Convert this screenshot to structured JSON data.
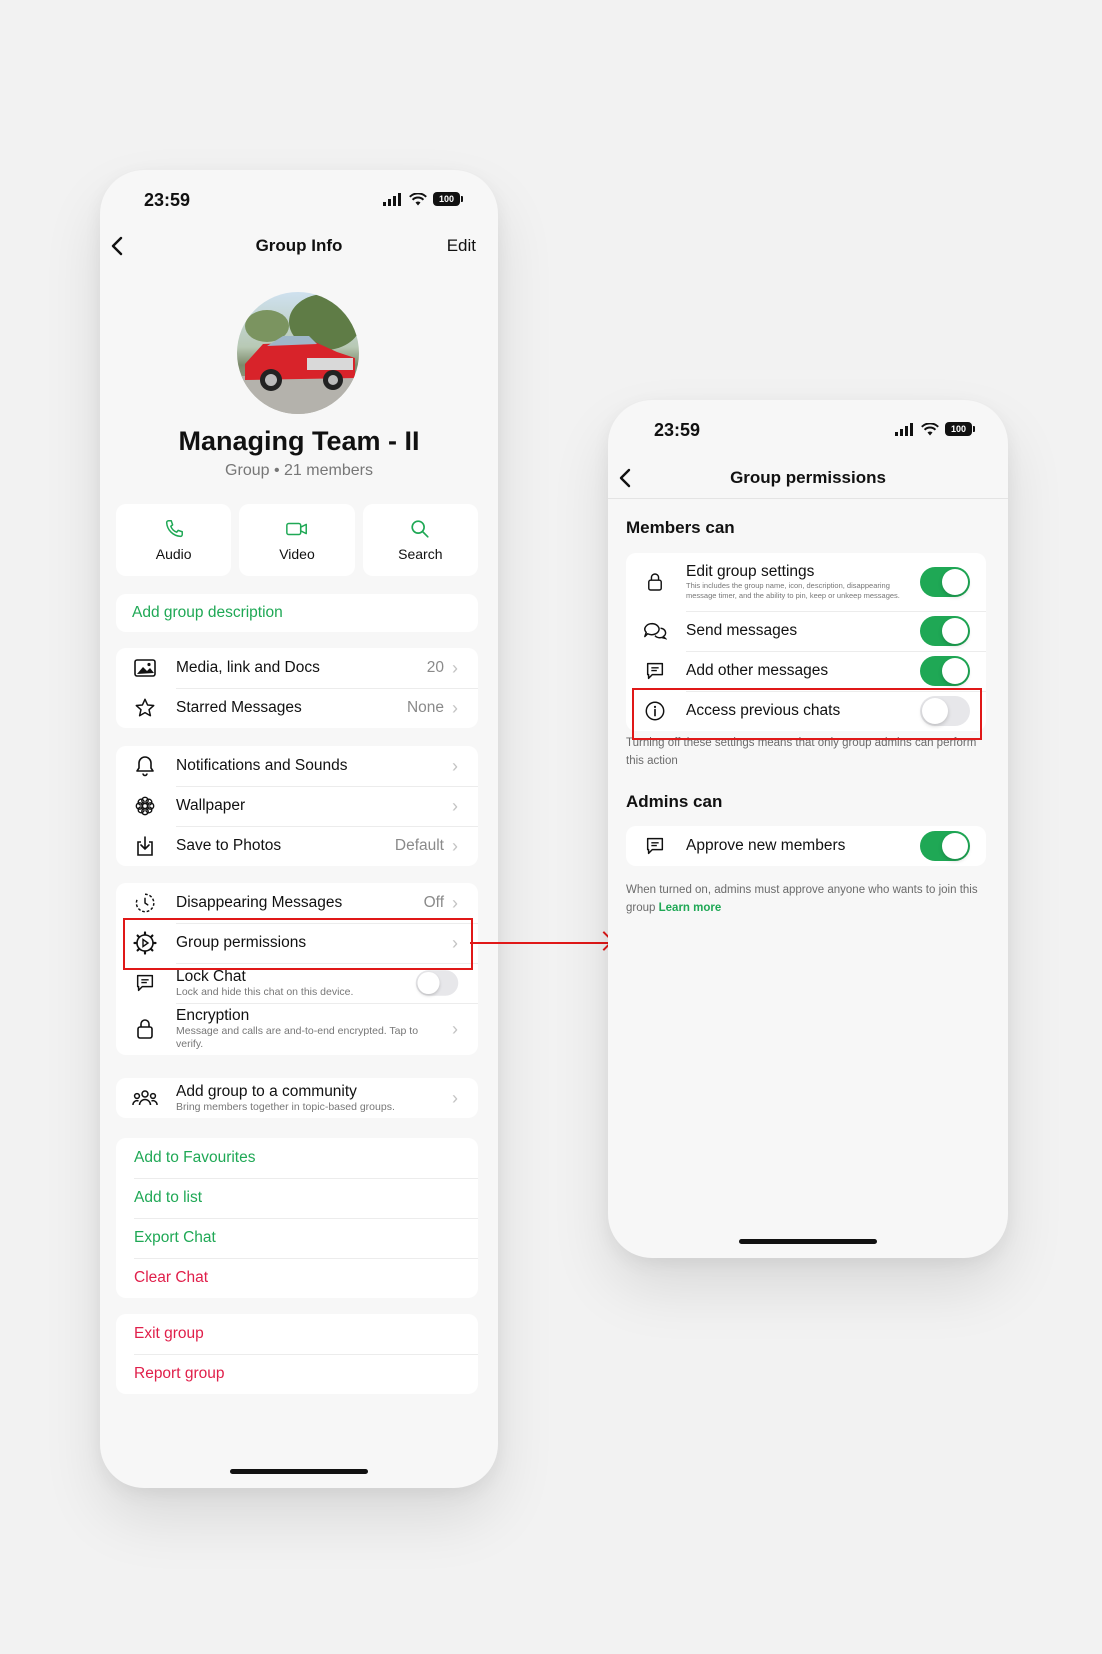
{
  "left_screen": {
    "status": {
      "time": "23:59",
      "battery": "100"
    },
    "nav": {
      "title": "Group Info",
      "edit": "Edit"
    },
    "group": {
      "name": "Managing Team - II",
      "type": "Group",
      "members": "21 members"
    },
    "actions": [
      {
        "label": "Audio",
        "icon": "phone-icon"
      },
      {
        "label": "Video",
        "icon": "video-icon"
      },
      {
        "label": "Search",
        "icon": "search-icon"
      }
    ],
    "add_description": "Add group description",
    "media": {
      "label": "Media, link and Docs",
      "value": "20"
    },
    "starred": {
      "label": "Starred Messages",
      "value": "None"
    },
    "notifications": "Notifications and Sounds",
    "wallpaper": "Wallpaper",
    "save_photos": {
      "label": "Save to Photos",
      "value": "Default"
    },
    "disappearing": {
      "label": "Disappearing Messages",
      "value": "Off"
    },
    "group_permissions": "Group permissions",
    "lock_chat": {
      "label": "Lock Chat",
      "sub": "Lock and hide this chat on this device.",
      "enabled": false
    },
    "encryption": {
      "label": "Encryption",
      "sub": "Message and calls are and-to-end encrypted. Tap to verify."
    },
    "community": {
      "label": "Add group to a community",
      "sub": "Bring members together in topic-based groups."
    },
    "list_actions": [
      "Add to Favourites",
      "Add to list",
      "Export Chat",
      "Clear Chat"
    ],
    "danger_actions": [
      "Exit group",
      "Report group"
    ]
  },
  "right_screen": {
    "status": {
      "time": "23:59",
      "battery": "100"
    },
    "nav": {
      "title": "Group permissions"
    },
    "members_title": "Members can",
    "edit_settings": {
      "label": "Edit group settings",
      "sub": "This includes the group name, icon, description, disappearing message timer, and the ability to pin, keep or unkeep messages.",
      "enabled": true
    },
    "send_messages": {
      "label": "Send messages",
      "enabled": true
    },
    "add_other": {
      "label": "Add other messages",
      "enabled": true
    },
    "access_previous": {
      "label": "Access previous chats",
      "enabled": false
    },
    "members_note": "Turning off these settings means that only group admins can perform this action",
    "admins_title": "Admins can",
    "approve": {
      "label": "Approve new members",
      "enabled": true
    },
    "admins_note": "When turned on, admins must approve anyone who wants to join this group",
    "learn_more": "Learn more"
  },
  "colors": {
    "accent_green": "#1fa855",
    "danger_red": "#e01f4a",
    "highlight_red": "#e01818"
  }
}
